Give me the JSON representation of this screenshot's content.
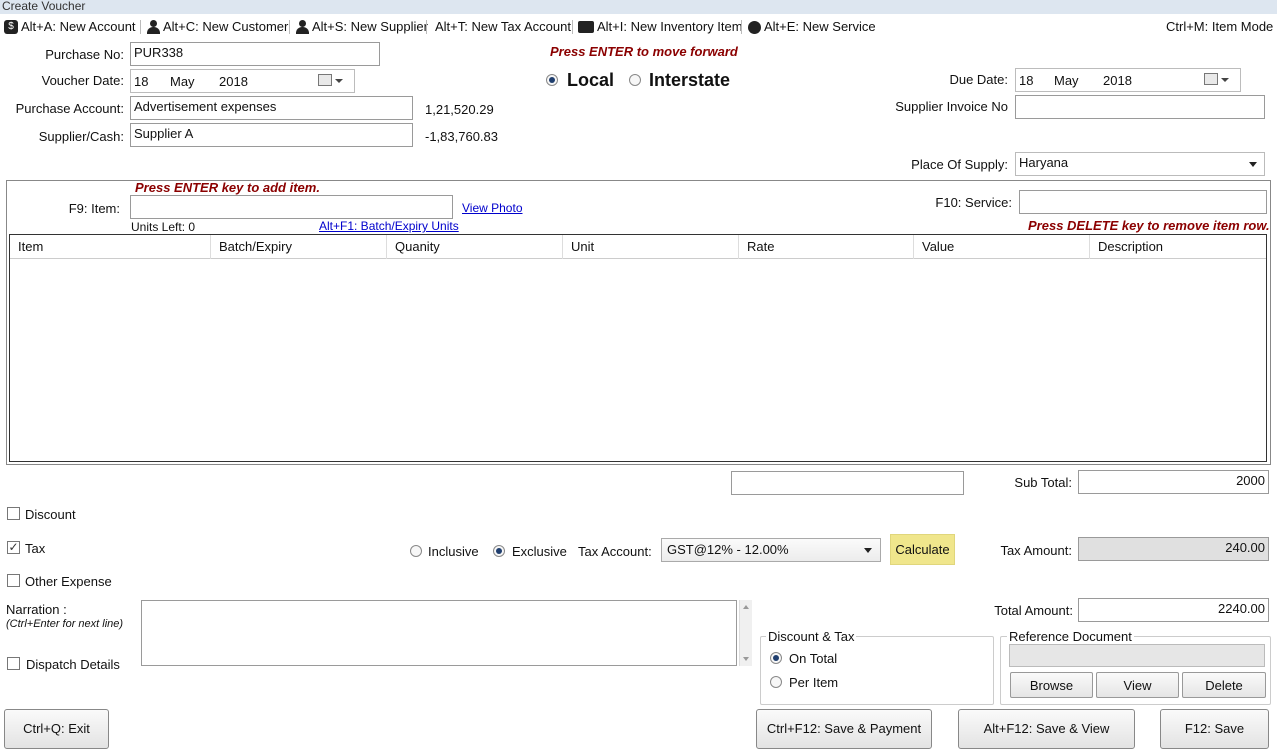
{
  "window": {
    "title": "Create Voucher"
  },
  "toolbar": {
    "new_account": "Alt+A: New Account",
    "new_customer": "Alt+C: New Customer",
    "new_supplier": "Alt+S: New Supplier",
    "new_tax_account": "Alt+T: New Tax Account",
    "new_inventory_item": "Alt+I: New Inventory Item",
    "new_service": "Alt+E: New Service",
    "item_mode": "Ctrl+M: Item Mode"
  },
  "header": {
    "purchase_no_label": "Purchase No:",
    "purchase_no": "PUR338",
    "voucher_date_label": "Voucher Date:",
    "voucher_date": {
      "day": "18",
      "month": "May",
      "year": "2018"
    },
    "purchase_account_label": "Purchase Account:",
    "purchase_account": "Advertisement expenses",
    "purchase_account_balance": "1,21,520.29",
    "supplier_label": "Supplier/Cash:",
    "supplier": "Supplier A",
    "supplier_balance": "-1,83,760.83",
    "enter_hint": "Press ENTER to move forward",
    "local_label": "Local",
    "interstate_label": "Interstate",
    "due_date_label": "Due Date:",
    "due_date": {
      "day": "18",
      "month": "May",
      "year": "2018"
    },
    "supplier_invoice_label": "Supplier Invoice No",
    "supplier_invoice": "",
    "place_of_supply_label": "Place Of Supply:",
    "place_of_supply": "Haryana"
  },
  "items": {
    "add_hint": "Press ENTER key to add item.",
    "item_label": "F9: Item:",
    "item_value": "",
    "view_photo": "View Photo",
    "units_left": "Units Left: 0",
    "batch_link": "Alt+F1: Batch/Expiry Units",
    "service_label": "F10: Service:",
    "service_value": "",
    "delete_hint": "Press DELETE key to remove item row.",
    "columns": [
      "Item",
      "Batch/Expiry",
      "Quanity",
      "Unit",
      "Rate",
      "Value",
      "Description"
    ]
  },
  "totals": {
    "extra_field": "",
    "sub_total_label": "Sub Total:",
    "sub_total": "2000",
    "tax_amount_label": "Tax Amount:",
    "tax_amount": "240.00",
    "total_amount_label": "Total Amount:",
    "total_amount": "2240.00"
  },
  "options": {
    "discount_label": "Discount",
    "tax_label": "Tax",
    "other_expense_label": "Other Expense",
    "dispatch_label": "Dispatch Details",
    "inclusive_label": "Inclusive",
    "exclusive_label": "Exclusive",
    "tax_account_label": "Tax Account:",
    "tax_account": "GST@12% - 12.00%",
    "calculate_label": "Calculate",
    "narration_label": "Narration :",
    "narration_hint": "(Ctrl+Enter for next line)",
    "narration": ""
  },
  "discount_tax": {
    "title": "Discount & Tax",
    "on_total": "On Total",
    "per_item": "Per Item"
  },
  "reference": {
    "title": "Reference Document",
    "path": "",
    "browse": "Browse",
    "view": "View",
    "delete": "Delete"
  },
  "footer": {
    "exit": "Ctrl+Q: Exit",
    "save_payment": "Ctrl+F12: Save & Payment",
    "save_view": "Alt+F12: Save & View",
    "save": "F12: Save"
  },
  "colors": {
    "hint": "#8b0000",
    "calculate_bg": "#f0e68c",
    "readonly_bg": "#e0e0e0"
  }
}
